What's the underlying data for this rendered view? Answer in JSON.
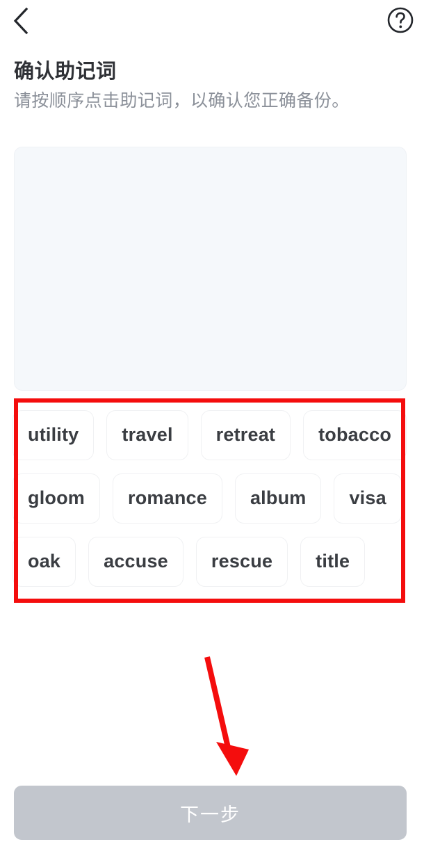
{
  "navbar": {
    "back_icon": "chevron-left-icon",
    "help_icon": "question-circle-icon"
  },
  "heading": {
    "title": "确认助记词",
    "subtitle": "请按顺序点击助记词，以确认您正确备份。"
  },
  "answer_panel": {
    "selected_words": [],
    "background": "#f5f8fb"
  },
  "word_bank": {
    "rows": [
      [
        "utility",
        "travel",
        "retreat",
        "tobacco"
      ],
      [
        "gloom",
        "romance",
        "album",
        "visa"
      ],
      [
        "oak",
        "accuse",
        "rescue",
        "title"
      ]
    ],
    "words": [
      "utility",
      "travel",
      "retreat",
      "tobacco",
      "gloom",
      "romance",
      "album",
      "visa",
      "oak",
      "accuse",
      "rescue",
      "title"
    ]
  },
  "annotations": {
    "highlight_color": "#f40d0d",
    "arrow_color": "#f40d0d"
  },
  "footer": {
    "next_label": "下一步",
    "next_disabled_color": "#c2c6cd"
  }
}
